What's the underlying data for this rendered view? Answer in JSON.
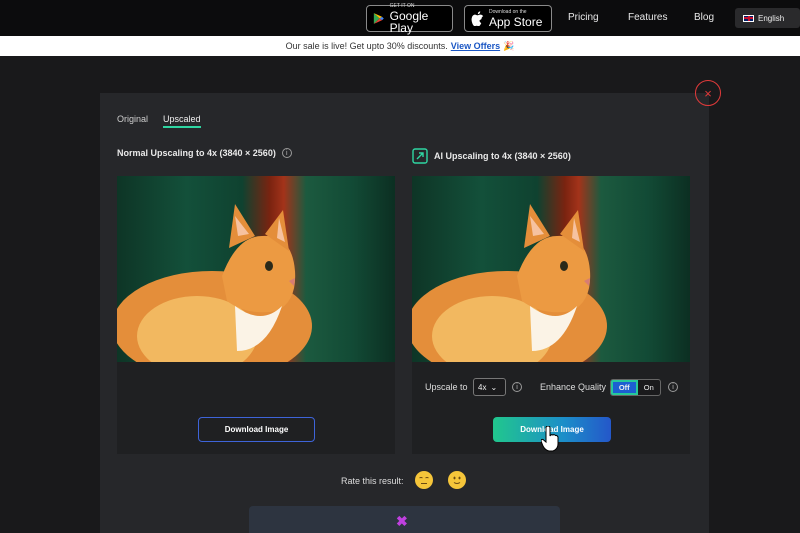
{
  "topnav": {
    "google_play": {
      "small": "GET IT ON",
      "big": "Google Play"
    },
    "app_store": {
      "small": "Download on the",
      "big": "App Store"
    },
    "links": [
      "Pricing",
      "Features",
      "Blog"
    ],
    "language": "English"
  },
  "banner": {
    "text": "Our sale is live! Get upto 30% discounts.",
    "link": "View Offers",
    "emoji": "🎉"
  },
  "modal": {
    "close": "×",
    "tabs": [
      {
        "label": "Original",
        "active": false
      },
      {
        "label": "Upscaled",
        "active": true
      }
    ],
    "left_panel": {
      "title": "Normal Upscaling to 4x (3840 × 2560)",
      "info": "i",
      "download": "Download Image"
    },
    "right_panel": {
      "title": "AI Upscaling to 4x (3840 × 2560)",
      "info": "i",
      "upscale_label": "Upscale to",
      "upscale_value": "4x",
      "enhance_label": "Enhance Quality",
      "toggle_off": "Off",
      "toggle_on": "On",
      "download": "Download Image"
    },
    "rating": {
      "label": "Rate this result:"
    }
  },
  "icons": {
    "accent": "#2fd6a2",
    "close": "#e23a3a",
    "download_gradient": [
      "#21c78d",
      "#2457c9"
    ]
  }
}
